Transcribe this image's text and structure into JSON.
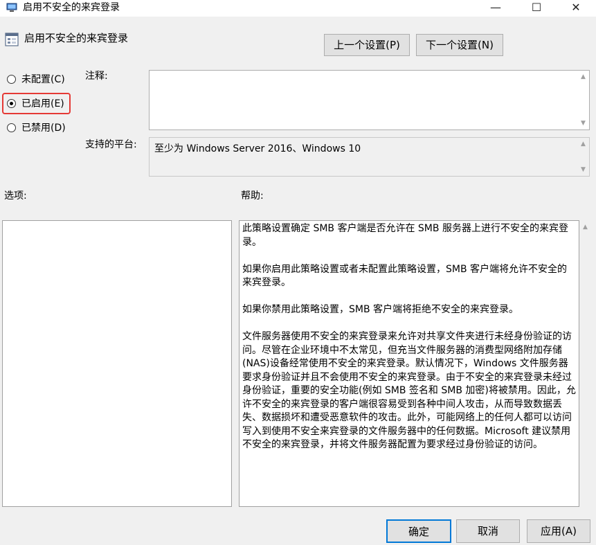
{
  "window": {
    "title": "启用不安全的来宾登录",
    "min_glyph": "—",
    "max_glyph": "☐",
    "close_glyph": "✕"
  },
  "header": {
    "policy_title": "启用不安全的来宾登录",
    "prev_button": "上一个设置(P)",
    "next_button": "下一个设置(N)"
  },
  "state": {
    "options": [
      {
        "label": "未配置(C)",
        "selected": false
      },
      {
        "label": "已启用(E)",
        "selected": true
      },
      {
        "label": "已禁用(D)",
        "selected": false
      }
    ],
    "highlight_color": "#e53935"
  },
  "comment": {
    "label": "注释:",
    "value": ""
  },
  "platform": {
    "label": "支持的平台:",
    "value": "至少为 Windows Server 2016、Windows 10"
  },
  "options_label": "选项:",
  "help": {
    "label": "帮助:",
    "paragraphs": [
      "此策略设置确定 SMB 客户端是否允许在 SMB 服务器上进行不安全的来宾登录。",
      "如果你启用此策略设置或者未配置此策略设置，SMB 客户端将允许不安全的来宾登录。",
      "如果你禁用此策略设置，SMB 客户端将拒绝不安全的来宾登录。",
      "文件服务器使用不安全的来宾登录来允许对共享文件夹进行未经身份验证的访问。尽管在企业环境中不太常见，但充当文件服务器的消费型网络附加存储(NAS)设备经常使用不安全的来宾登录。默认情况下，Windows 文件服务器要求身份验证并且不会使用不安全的来宾登录。由于不安全的来宾登录未经过身份验证，重要的安全功能(例如 SMB 签名和 SMB 加密)将被禁用。因此，允许不安全的来宾登录的客户端很容易受到各种中间人攻击，从而导致数据丢失、数据损坏和遭受恶意软件的攻击。此外，可能网络上的任何人都可以访问写入到使用不安全来宾登录的文件服务器中的任何数据。Microsoft 建议禁用不安全的来宾登录，并将文件服务器配置为要求经过身份验证的访问。"
    ]
  },
  "footer": {
    "ok": "确定",
    "cancel": "取消",
    "apply": "应用(A)"
  },
  "colors": {
    "accent": "#0078d7",
    "background": "#f0f0f0"
  }
}
